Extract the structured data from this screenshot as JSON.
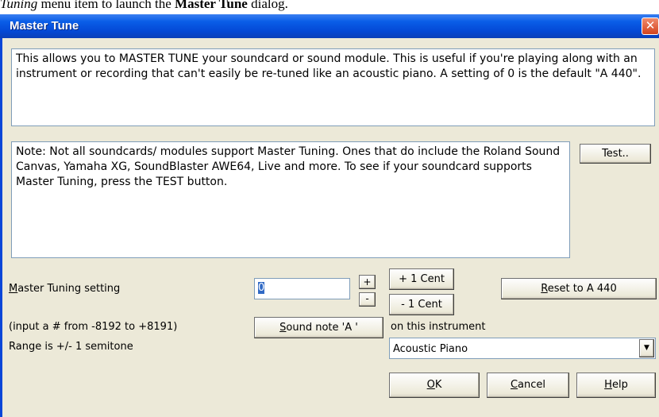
{
  "caption": {
    "part1": "Tuning",
    "part2": " menu item to launch the ",
    "part3": "Master Tune",
    "part4": " dialog."
  },
  "window": {
    "title": "Master Tune"
  },
  "info_text": "This allows you to MASTER TUNE your soundcard or sound module. This is useful if you're playing along with an instrument or recording that can't easily be re-tuned like an acoustic piano. A setting of 0 is the default \"A  440\".",
  "note_text": "Note: Not all soundcards/ modules support Master Tuning. Ones that do include the Roland Sound Canvas, Yamaha XG, SoundBlaster AWE64, Live and more. To see if your soundcard supports Master Tuning, press the TEST button.",
  "test_button": "Test..",
  "tuning": {
    "label_first": "M",
    "label_rest": "aster Tuning setting",
    "value": "0",
    "plus_label": "+",
    "minus_label": "-",
    "plus_cent": "+ 1 Cent",
    "minus_cent": "- 1 Cent",
    "reset_first": "R",
    "reset_rest": "eset to A 440",
    "input_hint": "(input a # from -8192 to +8191)",
    "range": "Range is +/- 1 semitone"
  },
  "sound": {
    "button_first": "S",
    "button_rest": "ound note 'A '",
    "instrument_label": "on this instrument",
    "instrument_selected": "Acoustic Piano"
  },
  "footer": {
    "ok_first": "O",
    "ok_rest": "K",
    "cancel_first": "C",
    "cancel_rest": "ancel",
    "help_first": "H",
    "help_rest": "elp"
  }
}
